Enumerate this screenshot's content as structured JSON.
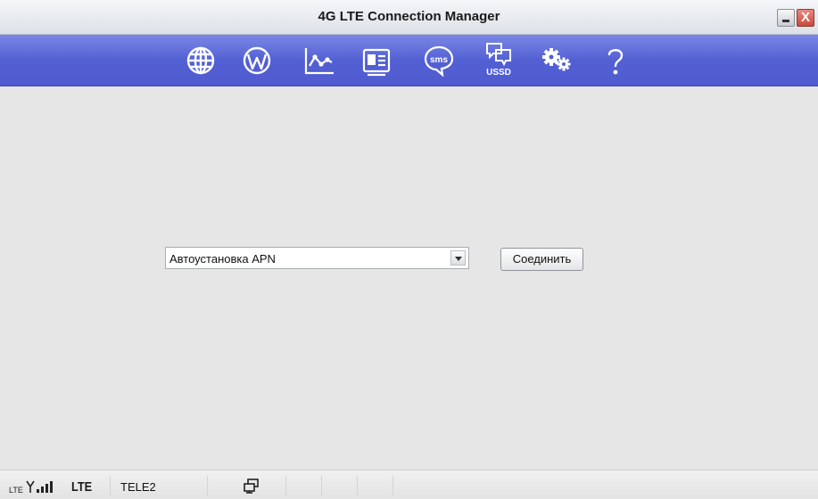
{
  "window": {
    "title": "4G LTE Connection Manager",
    "minimize_symbol": "_",
    "close_symbol": "X"
  },
  "toolbar": {
    "items": [
      {
        "icon": "globe-icon"
      },
      {
        "icon": "wordpress-icon"
      },
      {
        "icon": "statistics-chart-icon"
      },
      {
        "icon": "contacts-card-icon"
      },
      {
        "icon": "sms-bubble-icon",
        "label": "sms"
      },
      {
        "icon": "ussd-bubbles-icon",
        "label": "USSD"
      },
      {
        "icon": "settings-gears-icon"
      },
      {
        "icon": "help-question-icon"
      }
    ],
    "background": "#5360d4",
    "icon_color": "#ffffff"
  },
  "main": {
    "apn_select": {
      "selected": "Автоустановка APN"
    },
    "connect_button": {
      "label": "Соединить"
    }
  },
  "statusbar": {
    "signal_prefix": "LTE",
    "network_type": "LTE",
    "operator": "TELE2",
    "signal_icon": "signal-strength-icon",
    "network_icon": "network-computers-icon"
  }
}
